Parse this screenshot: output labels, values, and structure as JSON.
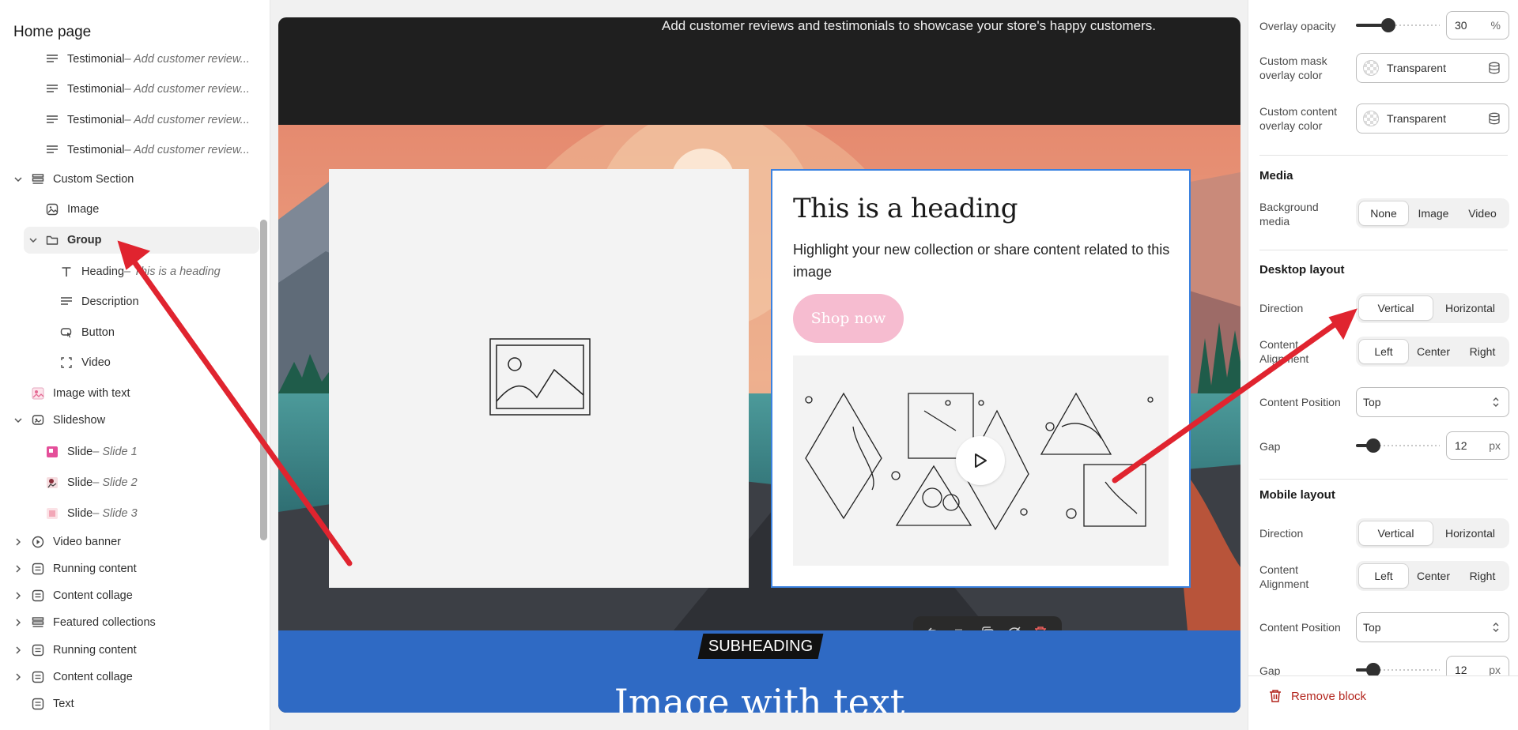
{
  "sidebar": {
    "title": "Home page",
    "items": [
      {
        "label": "Testimonial",
        "sub": " – Add customer review..."
      },
      {
        "label": "Testimonial",
        "sub": " – Add customer review..."
      },
      {
        "label": "Testimonial",
        "sub": " – Add customer review..."
      },
      {
        "label": "Testimonial",
        "sub": " – Add customer review..."
      },
      {
        "label": "Custom Section",
        "sub": ""
      },
      {
        "label": "Image",
        "sub": ""
      },
      {
        "label": "Group",
        "sub": ""
      },
      {
        "label": "Heading",
        "sub": " – This is a heading"
      },
      {
        "label": "Description",
        "sub": ""
      },
      {
        "label": "Button",
        "sub": ""
      },
      {
        "label": "Video",
        "sub": ""
      },
      {
        "label": "Image with text",
        "sub": ""
      },
      {
        "label": "Slideshow",
        "sub": ""
      },
      {
        "label": "Slide",
        "sub": " – Slide 1"
      },
      {
        "label": "Slide",
        "sub": " – Slide 2"
      },
      {
        "label": "Slide",
        "sub": " – Slide 3"
      },
      {
        "label": "Video banner",
        "sub": ""
      },
      {
        "label": "Running content",
        "sub": ""
      },
      {
        "label": "Content collage",
        "sub": ""
      },
      {
        "label": "Featured collections",
        "sub": ""
      },
      {
        "label": "Running content",
        "sub": ""
      },
      {
        "label": "Content collage",
        "sub": ""
      },
      {
        "label": "Text",
        "sub": ""
      }
    ]
  },
  "canvas": {
    "topbar_text": "Add customer reviews and testimonials to showcase your store's happy customers.",
    "heading": "This is a heading",
    "description": "Highlight your new collection or share content related to this image",
    "button": "Shop now",
    "subheading": "SUBHEADING",
    "big_title": "Image with text"
  },
  "panel": {
    "overlay_opacity_label": "Overlay opacity",
    "overlay_opacity_value": "30",
    "overlay_opacity_unit": "%",
    "overlay_opacity_fraction": 0.3,
    "mask_color_label": "Custom mask overlay color",
    "mask_color_value": "Transparent",
    "content_color_label": "Custom content overlay color",
    "content_color_value": "Transparent",
    "media_title": "Media",
    "bg_media_label": "Background media",
    "bg_media_options": [
      "None",
      "Image",
      "Video"
    ],
    "desktop_title": "Desktop layout",
    "direction_label": "Direction",
    "direction_options": [
      "Vertical",
      "Horizontal"
    ],
    "alignment_label_desktop": "Content Alignment",
    "alignment_label_mobile": "Content Alignment",
    "alignment_options": [
      "Left",
      "Center",
      "Right"
    ],
    "position_label": "Content Position",
    "position_value": "Top",
    "gap_label": "Gap",
    "gap_value": "12",
    "gap_unit": "px",
    "gap_fraction": 0.12,
    "mobile_title": "Mobile layout",
    "remove_block": "Remove block"
  },
  "colors": {
    "accent_blue": "#3b82e0",
    "button_pink": "#f6bcd0",
    "section_blue": "#2f6ac4",
    "danger_red": "#b3261e",
    "arrow_red": "#e0242f"
  }
}
